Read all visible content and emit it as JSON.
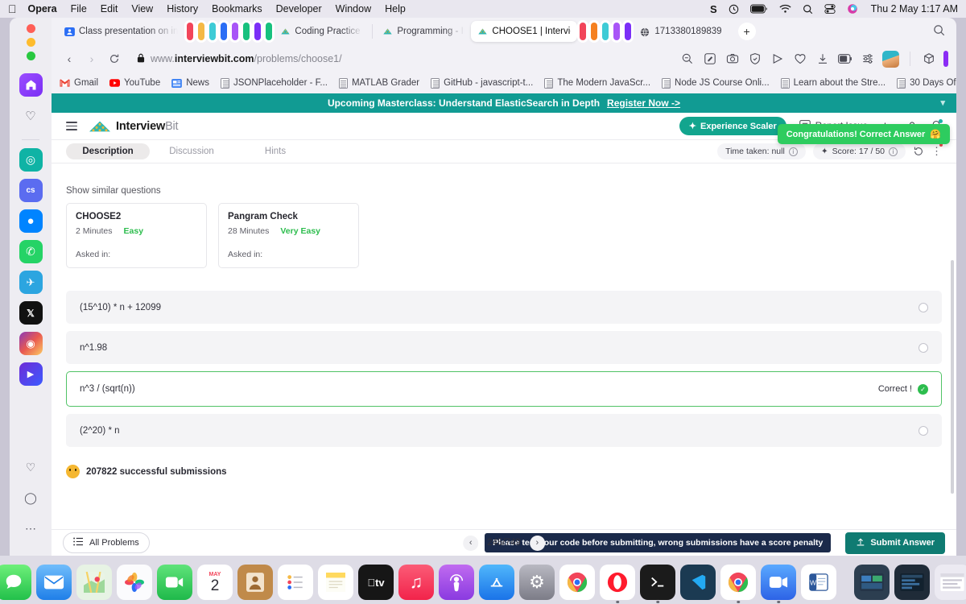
{
  "macos": {
    "app": "Opera",
    "menus": [
      "Opera",
      "File",
      "Edit",
      "View",
      "History",
      "Bookmarks",
      "Developer",
      "Window",
      "Help"
    ],
    "right_icons": [
      "dropbox-icon",
      "clock-icon",
      "battery-icon",
      "wifi-icon",
      "search-icon",
      "control-center-icon",
      "siri-icon"
    ],
    "clock": "Thu 2 May  1:17 AM"
  },
  "browser": {
    "tabs": [
      {
        "label": "Class presentation on in",
        "icon": "contact-icon",
        "active": false,
        "pill": null
      },
      {
        "label": "",
        "icon": null,
        "active": false,
        "pill": "#f2455a"
      },
      {
        "label": "",
        "icon": null,
        "active": false,
        "pill": "#f5b945"
      },
      {
        "label": "",
        "icon": null,
        "active": false,
        "pill": "#3ecbd6"
      },
      {
        "label": "",
        "icon": null,
        "active": false,
        "pill": "#2b6ef5"
      },
      {
        "label": "",
        "icon": null,
        "active": false,
        "pill": "#a855f7"
      },
      {
        "label": "",
        "icon": null,
        "active": false,
        "pill": "#17c17e"
      },
      {
        "label": "",
        "icon": null,
        "active": false,
        "pill": "#7b2ff7"
      },
      {
        "label": "Coding Practice | Coding",
        "icon": "interviewbit-icon",
        "active": false,
        "pill": "#17c17e"
      },
      {
        "label": "Programming - Interview",
        "icon": "interviewbit-icon",
        "active": false,
        "pill": null
      },
      {
        "label": "CHOOSE1 | Interviewbit",
        "icon": "interviewbit-icon",
        "active": true,
        "pill": null
      },
      {
        "label": "",
        "icon": null,
        "active": false,
        "pill": "#f2455a"
      },
      {
        "label": "",
        "icon": null,
        "active": false,
        "pill": "#f58020"
      },
      {
        "label": "",
        "icon": null,
        "active": false,
        "pill": "#3ecbd6"
      },
      {
        "label": "",
        "icon": null,
        "active": false,
        "pill": "#a855f7"
      },
      {
        "label": "",
        "icon": null,
        "active": false,
        "pill": "#7b2ff7"
      },
      {
        "label": "1713380189839",
        "icon": "globe-icon",
        "active": false,
        "pill": null
      }
    ],
    "new_tab_label": "+",
    "url": {
      "scheme": "www.",
      "domain": "interviewbit.com",
      "path": "/problems/choose1/"
    },
    "toolbar_icons": [
      "zoom-out-icon",
      "snapshot-icon",
      "camera-icon",
      "shield-icon",
      "player-icon",
      "heart-icon",
      "download-icon",
      "battery-saver-icon",
      "easy-setup-icon",
      "profile-avatar",
      "workspace-icon"
    ],
    "bookmarks": [
      {
        "label": "Gmail",
        "icon": "gmail-icon"
      },
      {
        "label": "YouTube",
        "icon": "youtube-icon"
      },
      {
        "label": "News",
        "icon": "news-icon"
      },
      {
        "label": "JSONPlaceholder - F...",
        "icon": "doc-icon"
      },
      {
        "label": "MATLAB Grader",
        "icon": "doc-icon"
      },
      {
        "label": "GitHub - javascript-t...",
        "icon": "doc-icon"
      },
      {
        "label": "The Modern JavaScr...",
        "icon": "doc-icon"
      },
      {
        "label": "Node JS Course Onli...",
        "icon": "doc-icon"
      },
      {
        "label": "Learn about the Stre...",
        "icon": "doc-icon"
      },
      {
        "label": "30 Days Of Node.js -...",
        "icon": "doc-icon"
      }
    ],
    "bookmarks_overflow": "»"
  },
  "sidebar": {
    "items": [
      {
        "name": "opera-home",
        "label": "O"
      },
      {
        "name": "favorites",
        "label": "♡"
      },
      {
        "name": "chatgpt",
        "label": "⬡"
      },
      {
        "name": "cs-panel",
        "label": "cs"
      },
      {
        "name": "messenger",
        "label": "m"
      },
      {
        "name": "whatsapp",
        "label": "✆"
      },
      {
        "name": "telegram",
        "label": "✈"
      },
      {
        "name": "x-twitter",
        "label": "𝕏"
      },
      {
        "name": "instagram",
        "label": "◎"
      },
      {
        "name": "music-player",
        "label": "▶"
      }
    ],
    "bottom": [
      {
        "name": "pinned-hearts",
        "label": "♡"
      },
      {
        "name": "history",
        "label": "◷"
      },
      {
        "name": "more",
        "label": "···"
      }
    ]
  },
  "banner": {
    "text": "Upcoming Masterclass: Understand ElasticSearch in Depth",
    "cta": "Register Now ->",
    "color": "#119b93"
  },
  "toast": {
    "text": "Congratulations! Correct Answer",
    "emoji": "🤗",
    "color": "#2ecc5f"
  },
  "app_header": {
    "logo_text_dark": "Interview",
    "logo_text_gray": "Bit",
    "scaler_button": "Experience Scaler",
    "report_issue": "Report Issue",
    "icons": [
      "activity-icon",
      "user-icon",
      "bell-icon"
    ]
  },
  "problem_tabs": [
    {
      "label": "Description",
      "active": true
    },
    {
      "label": "Discussion",
      "active": false
    },
    {
      "label": "Hints",
      "active": false
    }
  ],
  "meta": {
    "time_taken": "Time taken: null",
    "score": "Score: 17 / 50",
    "reset_icon": "reset-icon",
    "kebab_icon": "more-options-icon"
  },
  "similar": {
    "title": "Show similar questions",
    "cards": [
      {
        "title": "CHOOSE2",
        "time": "2 Minutes",
        "difficulty": "Easy",
        "asked": "Asked in:"
      },
      {
        "title": "Pangram Check",
        "time": "28 Minutes",
        "difficulty": "Very Easy",
        "asked": "Asked in:"
      }
    ]
  },
  "options": [
    {
      "text": "(15^10) * n + 12099",
      "state": "unselected"
    },
    {
      "text": "n^1.98",
      "state": "unselected"
    },
    {
      "text": "n^3 / (sqrt(n))",
      "state": "correct",
      "tag": "Correct !"
    },
    {
      "text": "(2^20) * n",
      "state": "unselected"
    }
  ],
  "submissions": "207822 successful submissions",
  "bottom_bar": {
    "all_problems": "All Problems",
    "pager": "245/749",
    "prev": "‹",
    "next": "›",
    "warning": "Please test your code before submitting, wrong submissions have a score penalty",
    "submit": "Submit Answer"
  },
  "dock": [
    {
      "name": "finder",
      "glyph": "🙂",
      "color": "#2a8df2"
    },
    {
      "name": "launchpad",
      "glyph": "⠿",
      "color": "#d7d7de"
    },
    {
      "name": "messages",
      "glyph": "💬",
      "color": "#4cd964"
    },
    {
      "name": "mail",
      "glyph": "✉",
      "color": "#3aa0f5"
    },
    {
      "name": "maps",
      "glyph": "🗺",
      "color": "#7ed07a"
    },
    {
      "name": "photos",
      "glyph": "❀",
      "color": "#f5f5f7"
    },
    {
      "name": "facetime",
      "glyph": "📹",
      "color": "#34c759"
    },
    {
      "name": "calendar",
      "glyph": "2",
      "color": "#ffffff"
    },
    {
      "name": "contacts",
      "glyph": "👤",
      "color": "#c08a4a"
    },
    {
      "name": "reminders",
      "glyph": "☰",
      "color": "#ffffff"
    },
    {
      "name": "notes",
      "glyph": "▤",
      "color": "#ffd95e"
    },
    {
      "name": "apple-tv",
      "glyph": "tv",
      "color": "#161616"
    },
    {
      "name": "music",
      "glyph": "♪",
      "color": "#fa3a57"
    },
    {
      "name": "podcasts",
      "glyph": "◉",
      "color": "#9b51e0"
    },
    {
      "name": "app-store",
      "glyph": "A",
      "color": "#2a8df2"
    },
    {
      "name": "system-settings",
      "glyph": "⚙",
      "color": "#8e8e93"
    },
    {
      "name": "chrome",
      "glyph": "◉",
      "color": "#ffffff"
    },
    {
      "name": "opera",
      "glyph": "O",
      "color": "#ff1b2d"
    },
    {
      "name": "terminal",
      "glyph": "›_",
      "color": "#1b1b1b"
    },
    {
      "name": "vscode",
      "glyph": "✂",
      "color": "#23a9f2"
    },
    {
      "name": "chrome-canary",
      "glyph": "◉",
      "color": "#ffffff"
    },
    {
      "name": "zoom",
      "glyph": "▭",
      "color": "#2d8cff"
    },
    {
      "name": "word",
      "glyph": "W",
      "color": "#2b579a"
    },
    {
      "name": "window-1",
      "glyph": "▦",
      "color": "#2c3e50"
    },
    {
      "name": "window-2",
      "glyph": "▦",
      "color": "#1f2b38"
    },
    {
      "name": "window-3",
      "glyph": "▤",
      "color": "#e8e8ee"
    },
    {
      "name": "window-4",
      "glyph": "▤",
      "color": "#e8e8ee"
    },
    {
      "name": "trash",
      "glyph": "🗑",
      "color": "#e3e3ea"
    }
  ]
}
